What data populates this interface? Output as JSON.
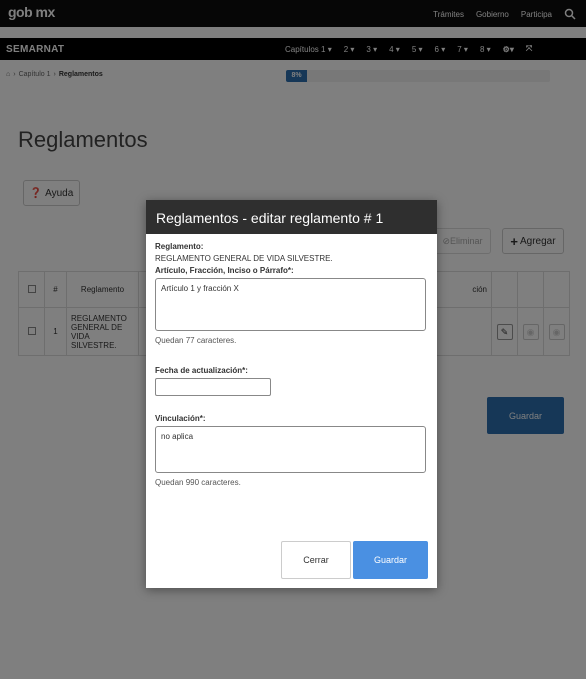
{
  "header": {
    "logo": "gob mx",
    "nav": [
      "Trámites",
      "Gobierno",
      "Participa"
    ]
  },
  "subheader": {
    "brand": "SEMARNAT",
    "chapters_label": "Capítulos 1",
    "chapters": [
      "2",
      "3",
      "4",
      "5",
      "6",
      "7",
      "8"
    ]
  },
  "breadcrumb": {
    "items": [
      "Capítulo 1",
      "Reglamentos"
    ]
  },
  "progress": {
    "label": "8%",
    "value_percent": 8,
    "color": "#2d6fae"
  },
  "page": {
    "title": "Reglamentos",
    "help_label": "Ayuda",
    "delete_label": "Eliminar",
    "add_label": "Agregar",
    "save_label": "Guardar"
  },
  "table": {
    "headers": [
      "#",
      "Reglamento",
      "ción"
    ],
    "rows": [
      {
        "num": "1",
        "reglamento": "REGLAMENTO GENERAL DE VIDA SILVESTRE."
      }
    ]
  },
  "modal": {
    "title": "Reglamentos - editar reglamento # 1",
    "reglamento_label": "Reglamento:",
    "reglamento_value": "REGLAMENTO GENERAL DE VIDA SILVESTRE.",
    "articulo_label": "Artículo, Fracción, Inciso o Párrafo*:",
    "articulo_value": "Artículo 1 y fracción X",
    "articulo_counter": "Quedan 77 caracteres.",
    "fecha_label": "Fecha de actualización*:",
    "fecha_value": "",
    "vinculacion_label": "Vinculación*:",
    "vinculacion_value": "no aplica",
    "vinculacion_counter": "Quedan 990 caracteres.",
    "close_label": "Cerrar",
    "save_label": "Guardar"
  },
  "colors": {
    "primary": "#4a90e2",
    "dark_header": "#2f2f2f",
    "save_blue": "#2d6fae"
  }
}
